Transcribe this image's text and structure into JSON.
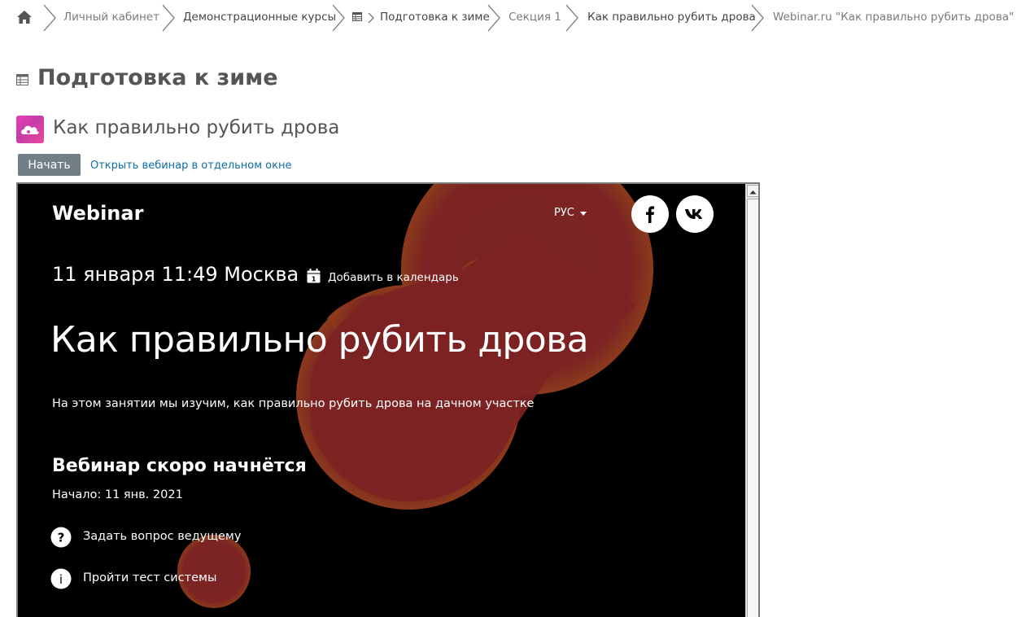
{
  "breadcrumb": {
    "items": [
      "Личный кабинет",
      "Демонстрационные курсы",
      "Подготовка к зиме",
      "Секция 1",
      "Как правильно рубить дрова",
      "Webinar.ru \"Как правильно рубить дрова\""
    ]
  },
  "page": {
    "title": "Подготовка к зиме"
  },
  "activity": {
    "title": "Как правильно рубить дрова",
    "start_button": "Начать",
    "open_link": "Открыть вебинар в отдельном окне"
  },
  "webinar": {
    "logo": "Webinar",
    "language": "РУС",
    "date": "11 января 11:49 Москва",
    "add_calendar": "Добавить в календарь",
    "calendar_day": "1",
    "title": "Как правильно рубить дрова",
    "description": "На этом занятии мы изучим, как правильно рубить дрова на дачном участке",
    "soon": "Вебинар скоро начнётся",
    "start": "Начало: 11 янв. 2021",
    "actions": [
      {
        "label": "Задать вопрос ведущему",
        "icon": "question-icon"
      },
      {
        "label": "Пройти тест системы",
        "icon": "info-icon"
      }
    ],
    "social": [
      "facebook-icon",
      "vk-icon"
    ]
  },
  "colors": {
    "blob": "#7c2323",
    "blob_edge": "#8f3a1e",
    "link": "#0f6fa5",
    "button": "#737f87",
    "app_icon": "#e63fb5"
  }
}
